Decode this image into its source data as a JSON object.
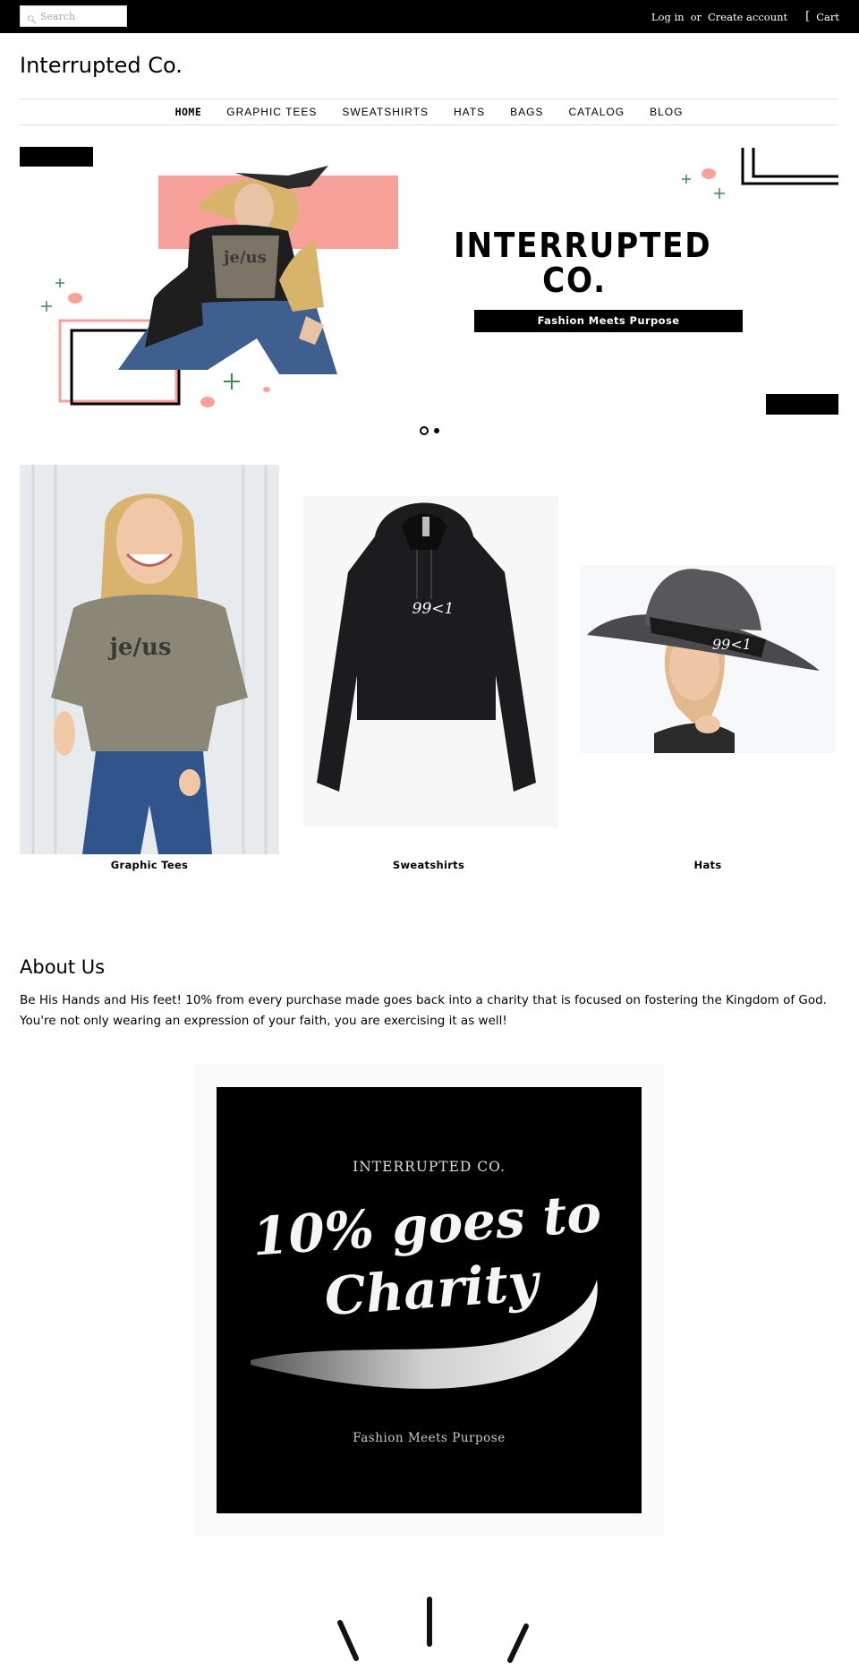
{
  "topbar": {
    "search_placeholder": "Search",
    "search_icon": "search-icon",
    "login_label": "Log in",
    "or_label": "or",
    "create_account_label": "Create account",
    "cart_icon": "cart-icon",
    "cart_label": "Cart"
  },
  "store": {
    "name": "Interrupted Co."
  },
  "nav": {
    "items": [
      {
        "label": "HOME",
        "active": true
      },
      {
        "label": "GRAPHIC TEES"
      },
      {
        "label": "SWEATSHIRTS"
      },
      {
        "label": "HATS"
      },
      {
        "label": "BAGS"
      },
      {
        "label": "CATALOG"
      },
      {
        "label": "BLOG"
      }
    ]
  },
  "hero": {
    "title_line1": "INTERRUPTED",
    "title_line2": "CO.",
    "subtitle": "Fashion Meets Purpose",
    "shirt_print": "je/us",
    "slide_count": 2,
    "active_slide": 1,
    "colors": {
      "pink": "#f8a09a",
      "green": "#3f8a5c",
      "black": "#000000"
    }
  },
  "collections": [
    {
      "caption": "Graphic Tees",
      "print": "je/us"
    },
    {
      "caption": "Sweatshirts",
      "print": "99<1"
    },
    {
      "caption": "Hats",
      "print": "99<1"
    }
  ],
  "about": {
    "heading": "About Us",
    "body": "Be His Hands and His feet!  10% from every purchase made goes back into a charity that is focused on fostering the Kingdom of God.  You're not only wearing an expression of your faith, you are exercising it as well!"
  },
  "charity_card": {
    "brand": "INTERRUPTED CO.",
    "line1": "10% goes to",
    "line2": "Charity",
    "tagline": "Fashion Meets Purpose"
  }
}
